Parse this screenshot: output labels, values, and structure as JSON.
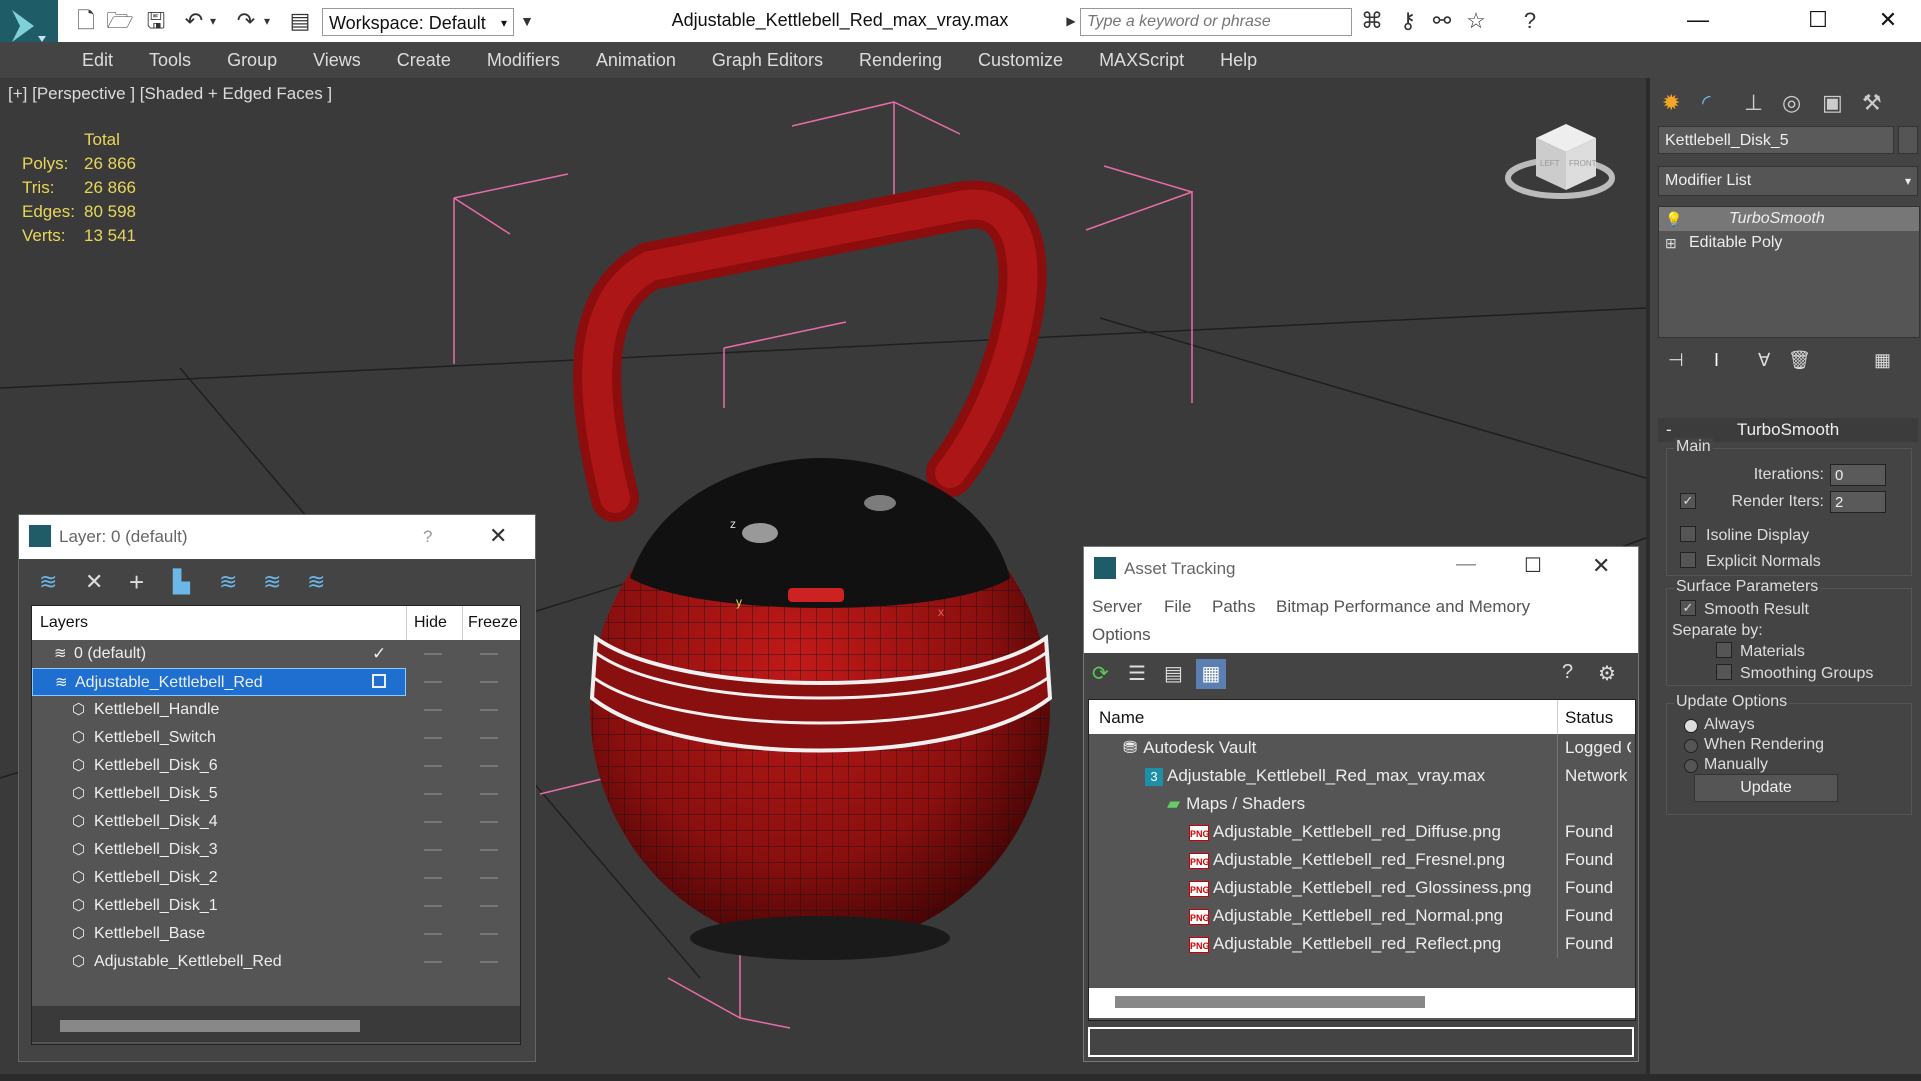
{
  "window": {
    "title": "Adjustable_Kettlebell_Red_max_vray.max",
    "workspace": "Workspace: Default",
    "search_placeholder": "Type a keyword or phrase"
  },
  "menu": [
    "Edit",
    "Tools",
    "Group",
    "Views",
    "Create",
    "Modifiers",
    "Animation",
    "Graph Editors",
    "Rendering",
    "Customize",
    "MAXScript",
    "Help"
  ],
  "viewport": {
    "label": "[+] [Perspective ] [Shaded + Edged Faces ]",
    "stats": {
      "header": "Total",
      "rows": [
        {
          "label": "Polys:",
          "value": "26 866"
        },
        {
          "label": "Tris:",
          "value": "26 866"
        },
        {
          "label": "Edges:",
          "value": "80 598"
        },
        {
          "label": "Verts:",
          "value": "13 541"
        }
      ]
    },
    "cube_labels": {
      "left": "LEFT",
      "front": "FRONT"
    },
    "axis": {
      "x": "x",
      "y": "y",
      "z": "z"
    }
  },
  "command_panel": {
    "object_name": "Kettlebell_Disk_5",
    "modifier_list": "Modifier List",
    "stack": [
      "TurboSmooth",
      "Editable Poly"
    ],
    "rollout_title": "TurboSmooth",
    "main": {
      "group": "Main",
      "iterations_label": "Iterations:",
      "iterations_value": "0",
      "render_iters_label": "Render Iters:",
      "render_iters_value": "2",
      "isoline": "Isoline Display",
      "explicit_normals": "Explicit Normals"
    },
    "surface": {
      "group": "Surface Parameters",
      "smooth_result": "Smooth Result",
      "separate_by": "Separate by:",
      "materials": "Materials",
      "smoothing_groups": "Smoothing Groups"
    },
    "update": {
      "group": "Update Options",
      "always": "Always",
      "when_rendering": "When Rendering",
      "manually": "Manually",
      "button": "Update"
    },
    "minus": "-"
  },
  "layer_dialog": {
    "title": "Layer: 0 (default)",
    "help": "?",
    "columns": {
      "layers": "Layers",
      "hide": "Hide",
      "freeze": "Freeze"
    },
    "rows": [
      {
        "name": "0 (default)",
        "indent": 1
      },
      {
        "name": "Adjustable_Kettlebell_Red",
        "indent": 1,
        "selected": true
      },
      {
        "name": "Kettlebell_Handle",
        "indent": 2
      },
      {
        "name": "Kettlebell_Switch",
        "indent": 2
      },
      {
        "name": "Kettlebell_Disk_6",
        "indent": 2
      },
      {
        "name": "Kettlebell_Disk_5",
        "indent": 2
      },
      {
        "name": "Kettlebell_Disk_4",
        "indent": 2
      },
      {
        "name": "Kettlebell_Disk_3",
        "indent": 2
      },
      {
        "name": "Kettlebell_Disk_2",
        "indent": 2
      },
      {
        "name": "Kettlebell_Disk_1",
        "indent": 2
      },
      {
        "name": "Kettlebell_Base",
        "indent": 2
      },
      {
        "name": "Adjustable_Kettlebell_Red",
        "indent": 2
      }
    ]
  },
  "asset_dialog": {
    "title": "Asset Tracking",
    "menu": [
      "Server",
      "File",
      "Paths",
      "Bitmap Performance and Memory",
      "Options"
    ],
    "columns": {
      "name": "Name",
      "status": "Status"
    },
    "rows": [
      {
        "name": "Autodesk Vault",
        "status": "Logged O",
        "indent": 0,
        "icon": "vault"
      },
      {
        "name": "Adjustable_Kettlebell_Red_max_vray.max",
        "status": "Network",
        "indent": 1,
        "icon": "max"
      },
      {
        "name": "Maps / Shaders",
        "status": "",
        "indent": 2,
        "icon": "maps"
      },
      {
        "name": "Adjustable_Kettlebell_red_Diffuse.png",
        "status": "Found",
        "indent": 3,
        "icon": "png"
      },
      {
        "name": "Adjustable_Kettlebell_red_Fresnel.png",
        "status": "Found",
        "indent": 3,
        "icon": "png"
      },
      {
        "name": "Adjustable_Kettlebell_red_Glossiness.png",
        "status": "Found",
        "indent": 3,
        "icon": "png"
      },
      {
        "name": "Adjustable_Kettlebell_red_Normal.png",
        "status": "Found",
        "indent": 3,
        "icon": "png"
      },
      {
        "name": "Adjustable_Kettlebell_red_Reflect.png",
        "status": "Found",
        "indent": 3,
        "icon": "png"
      }
    ],
    "png_label": "PNG"
  }
}
